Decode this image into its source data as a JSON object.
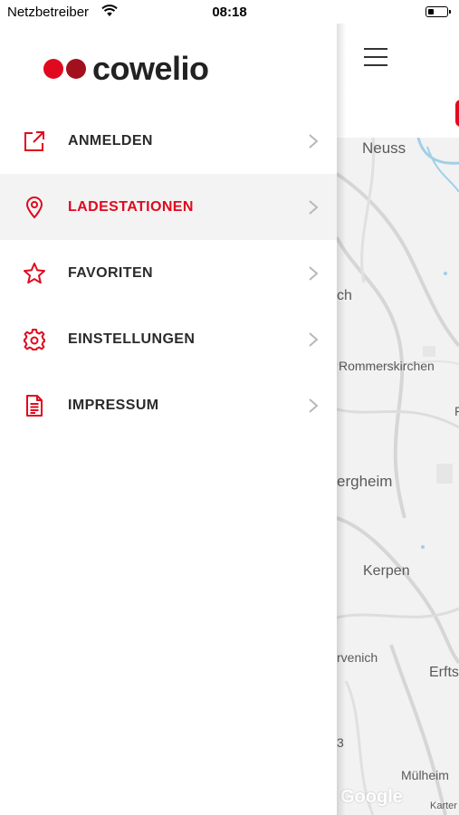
{
  "status_bar": {
    "carrier": "Netzbetreiber",
    "time": "08:18",
    "battery_level": 0.3
  },
  "brand": {
    "name": "cowelio",
    "colors": {
      "accent": "#e1091e",
      "dark_dot": "#a3101d"
    }
  },
  "menu": {
    "items": [
      {
        "label": "ANMELDEN",
        "icon": "external-link-icon",
        "active": false
      },
      {
        "label": "LADESTATIONEN",
        "icon": "map-pin-icon",
        "active": true
      },
      {
        "label": "FAVORITEN",
        "icon": "star-icon",
        "active": false
      },
      {
        "label": "EINSTELLUNGEN",
        "icon": "gear-icon",
        "active": false
      },
      {
        "label": "IMPRESSUM",
        "icon": "document-icon",
        "active": false
      }
    ]
  },
  "map": {
    "places": [
      "Neuss",
      "ch",
      "Rommerskirchen",
      "F",
      "ergheim",
      "Kerpen",
      "rvenich",
      "Erfts",
      "3",
      "Mülheim",
      "Karter"
    ],
    "attribution": "Google"
  }
}
